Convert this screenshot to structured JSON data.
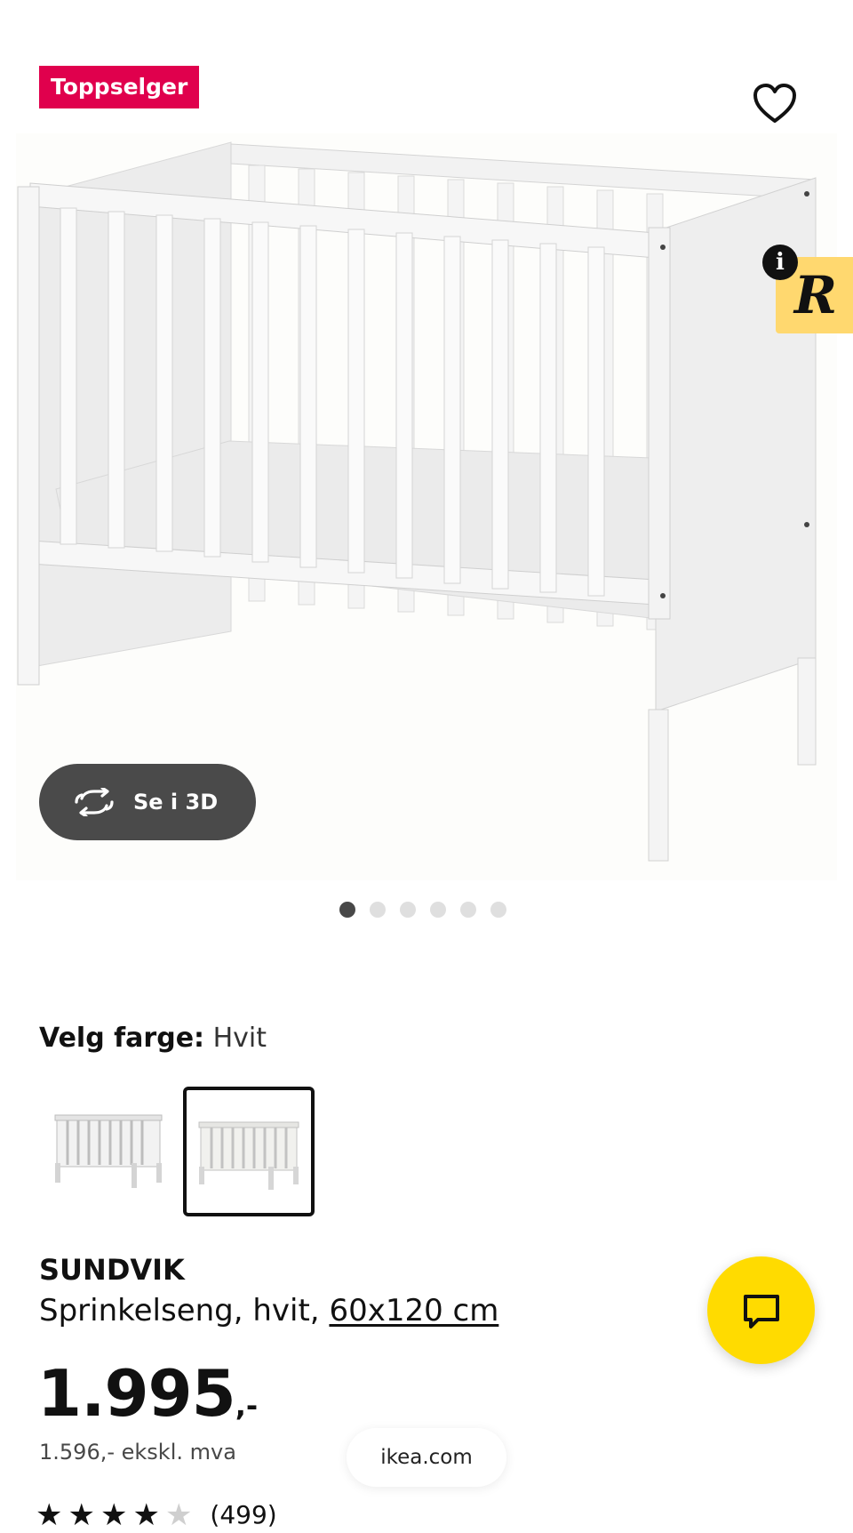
{
  "product": {
    "badge": "Toppselger",
    "three_d_button": "Se i 3D",
    "carousel": {
      "total": 6,
      "active": 1
    },
    "color": {
      "label": "Velg farge:",
      "value": "Hvit"
    },
    "swatches": [
      {
        "name": "white-crib-variant",
        "selected": false
      },
      {
        "name": "white-crib-variant-alt",
        "selected": true
      }
    ],
    "brand": "SUNDVIK",
    "description": "Sprinkelseng, hvit,",
    "measure": "60x120 cm",
    "price_main": "1.995",
    "price_suffix": ",-",
    "price_ex_vat": "1.596,- ekskl. mva",
    "rating": {
      "stars": 4.5,
      "count_text": "(499)"
    }
  },
  "overlays": {
    "info_glyph": "i",
    "r_extension_glyph": "R",
    "url": "ikea.com"
  },
  "icons": {
    "favorite": "heart-outline-icon",
    "rotate": "rotate-3d-icon",
    "chat": "chat-bubble-icon"
  },
  "colors": {
    "badge_bg": "#e0004d",
    "chat_bg": "#ffdb00",
    "r_badge_bg": "#ffd86f",
    "three_d_bg": "#4a4a4a"
  }
}
